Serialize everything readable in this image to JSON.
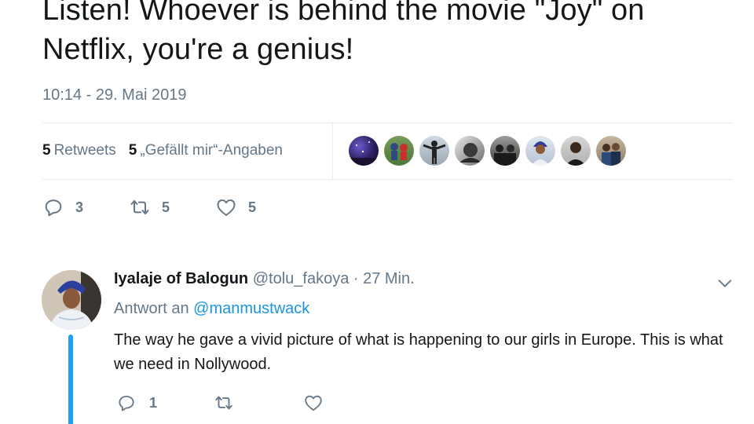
{
  "tweet": {
    "text": "Listen! Whoever is behind the movie \"Joy\" on Netflix, you're a genius!",
    "timestamp": "10:14 - 29. Mai 2019"
  },
  "stats": {
    "retweets_count": "5",
    "retweets_label": "Retweets",
    "likes_count": "5",
    "likes_label": "„Gefällt mir“-Angaben"
  },
  "liker_avatars": [
    {
      "icon": "avatar-night-sky"
    },
    {
      "icon": "avatar-soccer"
    },
    {
      "icon": "avatar-person-arms-out"
    },
    {
      "icon": "avatar-grayscale"
    },
    {
      "icon": "avatar-group-dark"
    },
    {
      "icon": "avatar-woman-headwrap"
    },
    {
      "icon": "avatar-man-dark"
    },
    {
      "icon": "avatar-couple"
    }
  ],
  "actions": {
    "reply_count": "3",
    "retweet_count": "5",
    "like_count": "5"
  },
  "reply": {
    "name": "Iyalaje of Balogun",
    "meta": "@tolu_fakoya · 27 Min.",
    "reply_to_prefix": "Antwort an",
    "reply_to_handle": "@manmustwack",
    "text": "The way he gave a vivid picture of what is happening to our girls in Europe. This is what we need in Nollywood.",
    "reply_count": "1",
    "retweet_count": "",
    "like_count": ""
  },
  "colors": {
    "accent": "#1da1f2",
    "link": "#1b95e0",
    "muted": "#657786",
    "text": "#14171a",
    "divider": "#e6ecf0"
  }
}
